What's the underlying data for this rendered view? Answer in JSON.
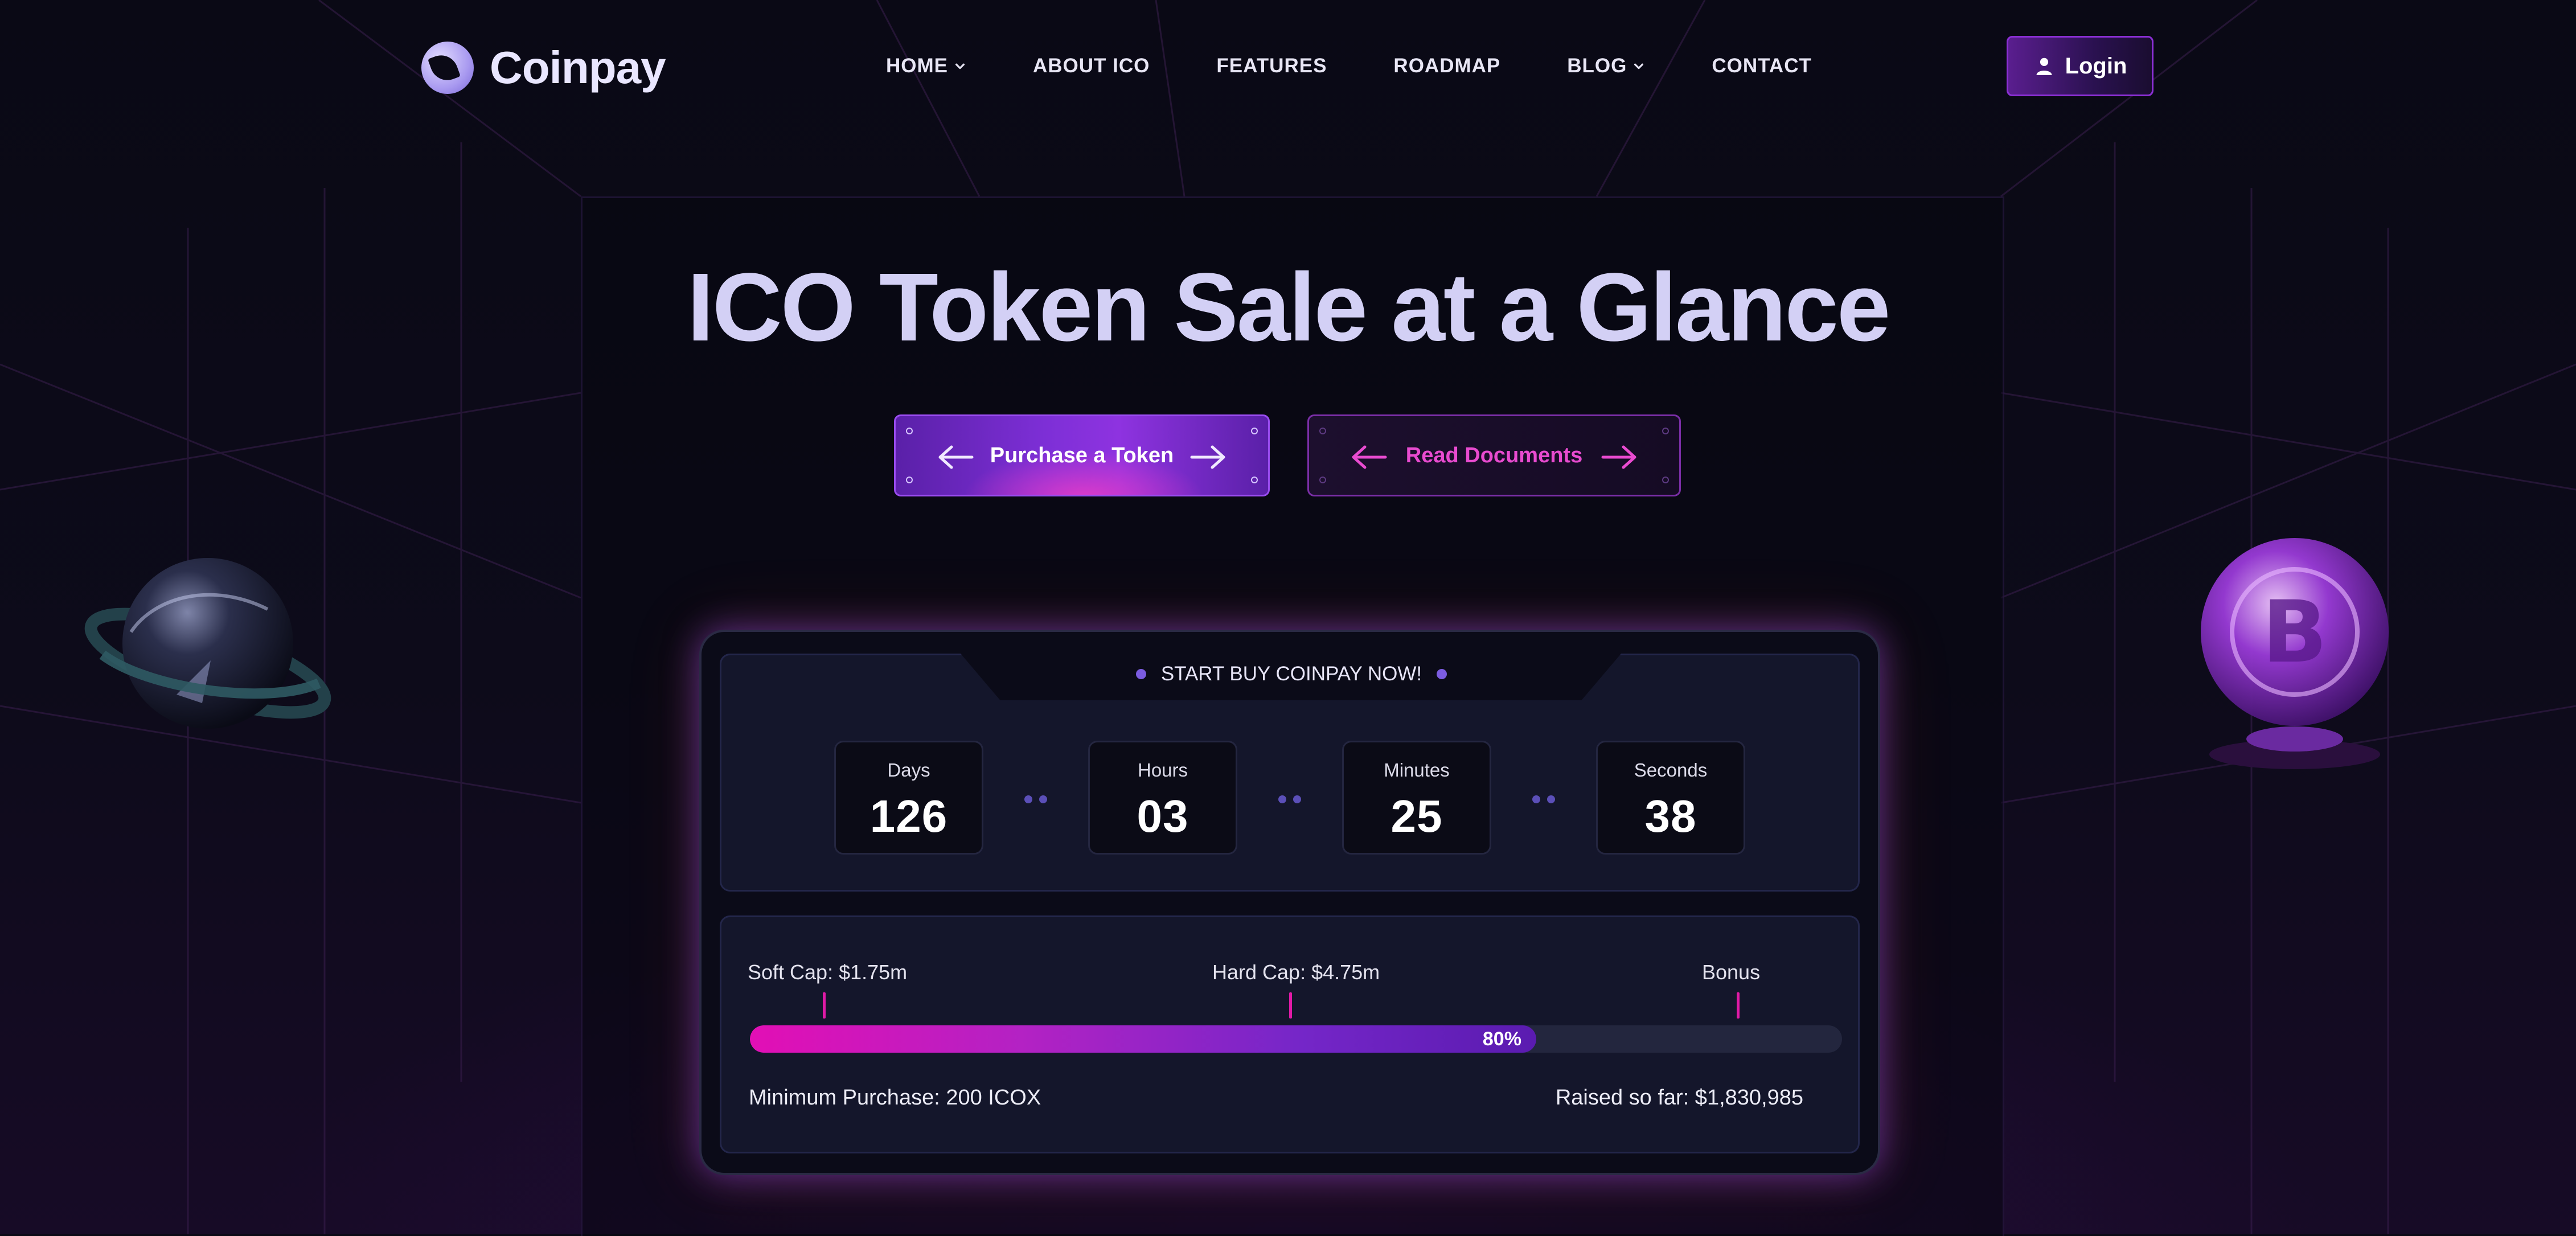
{
  "brand": {
    "name": "Coinpay",
    "logo_icon": "coinpay-logo-icon"
  },
  "nav": {
    "items": [
      {
        "label": "HOME",
        "has_dropdown": true
      },
      {
        "label": "ABOUT ICO",
        "has_dropdown": false
      },
      {
        "label": "FEATURES",
        "has_dropdown": false
      },
      {
        "label": "ROADMAP",
        "has_dropdown": false
      },
      {
        "label": "BLOG",
        "has_dropdown": true
      },
      {
        "label": "CONTACT",
        "has_dropdown": false
      }
    ]
  },
  "login": {
    "label": "Login",
    "icon": "user-icon"
  },
  "hero": {
    "title": "ICO Token Sale at a Glance",
    "primary_cta": "Purchase a Token",
    "secondary_cta": "Read Documents"
  },
  "sale": {
    "banner": "START BUY COINPAY NOW!",
    "countdown": [
      {
        "label": "Days",
        "value": "126"
      },
      {
        "label": "Hours",
        "value": "03"
      },
      {
        "label": "Minutes",
        "value": "25"
      },
      {
        "label": "Seconds",
        "value": "38"
      }
    ],
    "soft_cap": "Soft Cap: $1.75m",
    "hard_cap": "Hard Cap: $4.75m",
    "bonus": "Bonus",
    "progress_percent": 72,
    "progress_label": "80%",
    "min_purchase": "Minimum Purchase: 200 ICOX",
    "raised": "Raised so far: $1,830,985"
  },
  "colors": {
    "background": "#0b0a16",
    "accent_pink": "#e20fb5",
    "accent_purple": "#7526c8",
    "title": "#d3d0f5"
  }
}
